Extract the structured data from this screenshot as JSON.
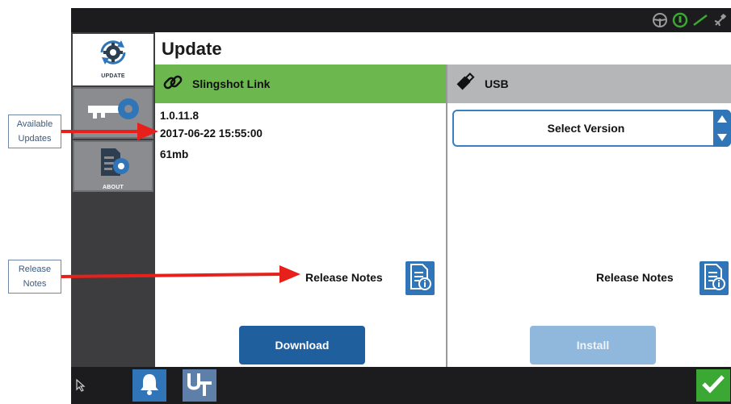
{
  "annotations": {
    "available_updates": "Available Updates",
    "release_notes": "Release Notes"
  },
  "sidebar": {
    "items": [
      {
        "label": "UPDATE",
        "icon": "refresh-gear-icon",
        "active": true
      },
      {
        "label": "",
        "icon": "key-icon",
        "active": false
      },
      {
        "label": "ABOUT",
        "icon": "document-gear-icon",
        "active": false
      }
    ]
  },
  "page": {
    "title": "Update"
  },
  "left_panel": {
    "title": "Slingshot Link",
    "icon": "link-icon",
    "version": "1.0.11.8",
    "date": "2017-06-22 15:55:00",
    "size": "61mb",
    "release_notes_label": "Release Notes",
    "download_label": "Download"
  },
  "right_panel": {
    "title": "USB",
    "icon": "usb-drive-icon",
    "select_label": "Select Version",
    "release_notes_label": "Release Notes",
    "install_label": "Install"
  },
  "colors": {
    "header_green": "#6cb84e",
    "header_gray": "#b4b6b8",
    "primary_blue": "#1f5f9e",
    "disabled_blue": "#8fb8dc",
    "confirm_green": "#3aa832",
    "annotation_red": "#e8201c"
  }
}
